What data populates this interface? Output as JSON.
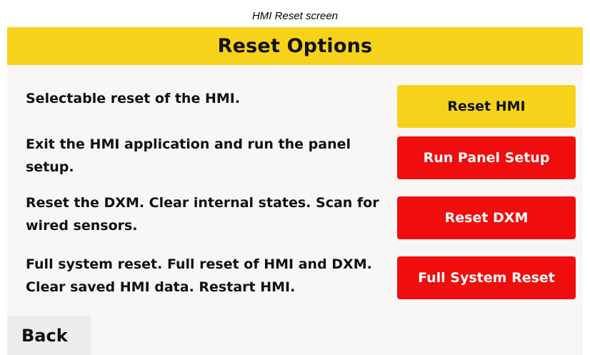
{
  "caption": "HMI Reset screen",
  "header": {
    "title": "Reset Options"
  },
  "rows": [
    {
      "description": "Selectable reset of the HMI.",
      "button_label": "Reset HMI"
    },
    {
      "description": "Exit the HMI application and run the panel setup.",
      "button_label": "Run Panel Setup"
    },
    {
      "description": "Reset the DXM. Clear internal states. Scan for wired sensors.",
      "button_label": "Reset DXM"
    },
    {
      "description": "Full system reset. Full reset of HMI and DXM. Clear saved HMI data. Restart HMI.",
      "button_label": "Full System Reset"
    }
  ],
  "footer": {
    "back_label": "Back"
  },
  "colors": {
    "accent_yellow": "#f7d21a",
    "action_red": "#f00d0d",
    "screen_background": "#f8f7f6"
  }
}
